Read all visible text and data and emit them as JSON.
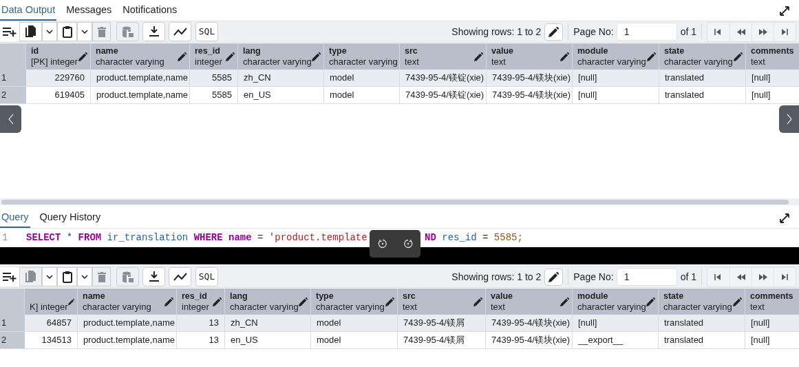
{
  "tabs": [
    {
      "label": "Data Output",
      "selected": true
    },
    {
      "label": "Messages",
      "selected": false
    },
    {
      "label": "Notifications",
      "selected": false
    }
  ],
  "grids": [
    {
      "toolbar": {
        "tools": [
          {
            "kind": "add-row",
            "disabled": false
          },
          {
            "kind": "copy",
            "disabled": false
          },
          {
            "kind": "caret",
            "disabled": false
          },
          {
            "kind": "paste",
            "disabled": false
          },
          {
            "kind": "caret",
            "disabled": false
          },
          {
            "kind": "delete",
            "disabled": true
          },
          {
            "kind": "save",
            "disabled": true
          },
          {
            "kind": "download",
            "disabled": false
          },
          {
            "kind": "graph",
            "disabled": false
          },
          {
            "kind": "sql",
            "label": "SQL",
            "disabled": false
          }
        ],
        "showing": "Showing rows: 1 to 2",
        "page_label": "Page No:",
        "page_value": "1",
        "page_total": "of 1"
      },
      "columns": [
        {
          "name": "id",
          "type": "[PK] integer",
          "numeric": true
        },
        {
          "name": "name",
          "type": "character varying",
          "numeric": false
        },
        {
          "name": "res_id",
          "type": "integer",
          "numeric": true
        },
        {
          "name": "lang",
          "type": "character varying",
          "numeric": false
        },
        {
          "name": "type",
          "type": "character varying",
          "numeric": false
        },
        {
          "name": "src",
          "type": "text",
          "numeric": false
        },
        {
          "name": "value",
          "type": "text",
          "numeric": false
        },
        {
          "name": "module",
          "type": "character varying",
          "numeric": false
        },
        {
          "name": "state",
          "type": "character varying",
          "numeric": false
        },
        {
          "name": "comments",
          "type": "text",
          "numeric": false
        }
      ],
      "rows": [
        {
          "number": "1",
          "cells": [
            "229760",
            "product.template,name",
            "5585",
            "zh_CN",
            "model",
            "7439-95-4/镁锭(xie)",
            "7439-95-4/镁块(xie)",
            "[null]",
            "translated",
            "[null]"
          ]
        },
        {
          "number": "2",
          "cells": [
            "619405",
            "product.template,name",
            "5585",
            "en_US",
            "model",
            "7439-95-4/镁锭(xie)",
            "7439-95-4/镁块(xie)",
            "[null]",
            "translated",
            "[null]"
          ]
        }
      ]
    },
    {
      "toolbar": {
        "tools": [
          {
            "kind": "add-row",
            "disabled": false
          },
          {
            "kind": "copy",
            "disabled": true
          },
          {
            "kind": "caret",
            "disabled": false
          },
          {
            "kind": "paste",
            "disabled": false
          },
          {
            "kind": "caret",
            "disabled": false
          },
          {
            "kind": "delete",
            "disabled": true
          },
          {
            "kind": "save",
            "disabled": true
          },
          {
            "kind": "download",
            "disabled": false
          },
          {
            "kind": "graph",
            "disabled": false
          },
          {
            "kind": "sql",
            "label": "SQL",
            "disabled": false
          }
        ],
        "showing": "Showing rows: 1 to 2",
        "page_label": "Page No:",
        "page_value": "1",
        "page_total": "of 1"
      },
      "columns": [
        {
          "type": "K] integer",
          "numeric": true
        },
        {
          "name": "name",
          "type": "character varying",
          "numeric": false
        },
        {
          "name": "res_id",
          "type": "integer",
          "numeric": true
        },
        {
          "name": "lang",
          "type": "character varying",
          "numeric": false
        },
        {
          "name": "type",
          "type": "character varying",
          "numeric": false
        },
        {
          "name": "src",
          "type": "text",
          "numeric": false
        },
        {
          "name": "value",
          "type": "text",
          "numeric": false
        },
        {
          "name": "module",
          "type": "character varying",
          "numeric": false
        },
        {
          "name": "state",
          "type": "character varying",
          "numeric": false
        },
        {
          "name": "comments",
          "type": "text",
          "numeric": false
        }
      ],
      "rows": [
        {
          "number": "1",
          "cells": [
            "64857",
            "product.template,name",
            "13",
            "zh_CN",
            "model",
            "7439-95-4/镁屑",
            "7439-95-4/镁块(xie)",
            "[null]",
            "translated",
            "[null]"
          ]
        },
        {
          "number": "2",
          "cells": [
            "134513",
            "product.template,name",
            "13",
            "en_US",
            "model",
            "7439-95-4/镁屑",
            "7439-95-4/镁块(xie)",
            "__export__",
            "translated",
            "[null]"
          ]
        }
      ]
    }
  ],
  "query_tabs": [
    {
      "label": "Query",
      "selected": true
    },
    {
      "label": "Query History",
      "selected": false
    }
  ],
  "editor": {
    "line_number": "1",
    "tokens": [
      {
        "kind": "keyword",
        "text": "SELECT"
      },
      {
        "kind": "operator",
        "text": "*"
      },
      {
        "kind": "keyword",
        "text": "FROM"
      },
      {
        "kind": "identifier",
        "text": "ir_translation"
      },
      {
        "kind": "keyword",
        "text": "WHERE"
      },
      {
        "kind": "keyword",
        "text": "name"
      },
      {
        "kind": "operator",
        "text": "="
      },
      {
        "kind": "string",
        "text": "'product.template"
      },
      {
        "kind": "hidden"
      },
      {
        "kind": "keyword",
        "text": "ND"
      },
      {
        "kind": "identifier",
        "text": "res_id"
      },
      {
        "kind": "operator",
        "text": "="
      },
      {
        "kind": "number",
        "text": "5585;"
      }
    ]
  }
}
